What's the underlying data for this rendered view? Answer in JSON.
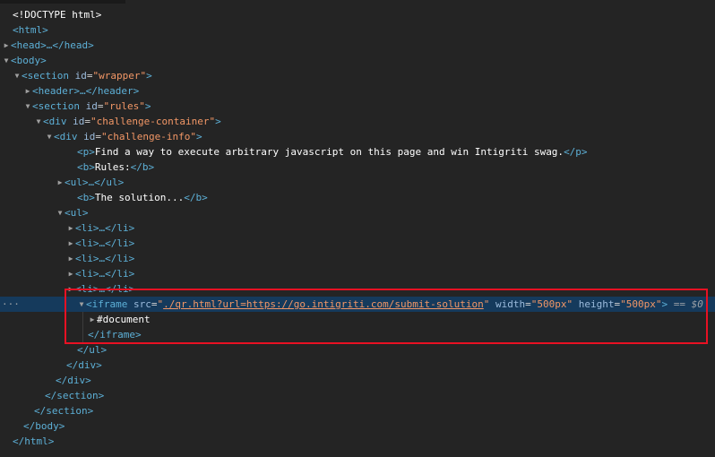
{
  "lines": [
    {
      "i": "0",
      "text": "<!DOCTYPE html>"
    },
    {
      "i": "1",
      "open": "<html>"
    },
    {
      "i": "2",
      "collapsed": "<head>…</head>"
    },
    {
      "i": "3",
      "open": "<body>"
    },
    {
      "i": "4",
      "tag": "section",
      "attr": "id",
      "val": "\"wrapper\""
    },
    {
      "i": "5",
      "collapsed": "<header>…</header>"
    },
    {
      "i": "6",
      "tag": "section",
      "attr": "id",
      "val": "\"rules\""
    },
    {
      "i": "7",
      "tag": "div",
      "attr": "id",
      "val": "\"challenge-container\""
    },
    {
      "i": "8",
      "tag": "div",
      "attr": "id",
      "val": "\"challenge-info\""
    },
    {
      "i": "9",
      "p_open": "<p>",
      "p_text": "Find a way to execute arbitrary javascript on this page and win Intigriti swag.",
      "p_close": "</p>"
    },
    {
      "i": "10",
      "b_open": "<b>",
      "b_text": "Rules:",
      "b_close": "</b>"
    },
    {
      "i": "11",
      "collapsed": "<ul>…</ul>"
    },
    {
      "i": "12",
      "b_open": "<b>",
      "b_text": "The solution...",
      "b_close": "</b>"
    },
    {
      "i": "13",
      "open": "<ul>"
    },
    {
      "i": "14",
      "collapsed": "<li>…</li>"
    },
    {
      "i": "15",
      "collapsed": "<li>…</li>"
    },
    {
      "i": "16",
      "collapsed": "<li>…</li>"
    },
    {
      "i": "17",
      "collapsed": "<li>…</li>"
    },
    {
      "i": "18",
      "collapsed": "<li>…</li>"
    },
    {
      "i": "19",
      "close": "</ul>"
    },
    {
      "i": "20",
      "close": "</div>"
    },
    {
      "i": "21",
      "close": "</div>"
    },
    {
      "i": "22",
      "close": "</section>"
    },
    {
      "i": "23",
      "close": "</section>"
    },
    {
      "i": "24",
      "close": "</body>"
    },
    {
      "i": "25",
      "close": "</html>"
    }
  ],
  "iframe": {
    "open_tag": "<iframe",
    "src_attr": "src",
    "src_val": "./qr.html?url=https://go.intigriti.com/submit-solution",
    "width_attr": "width",
    "width_val": "\"500px\"",
    "height_attr": "height",
    "height_val": "\"500px\"",
    "end": ">",
    "eq": "==",
    "dollar": "$0",
    "document": "#document",
    "close": "</iframe>"
  },
  "sel_dots": "···",
  "colors": {
    "background": "#242424",
    "selected": "#153a5c",
    "tag": "#5db0d7",
    "attr": "#9bbbdc",
    "value": "#f29766",
    "highlight": "#e81123"
  }
}
